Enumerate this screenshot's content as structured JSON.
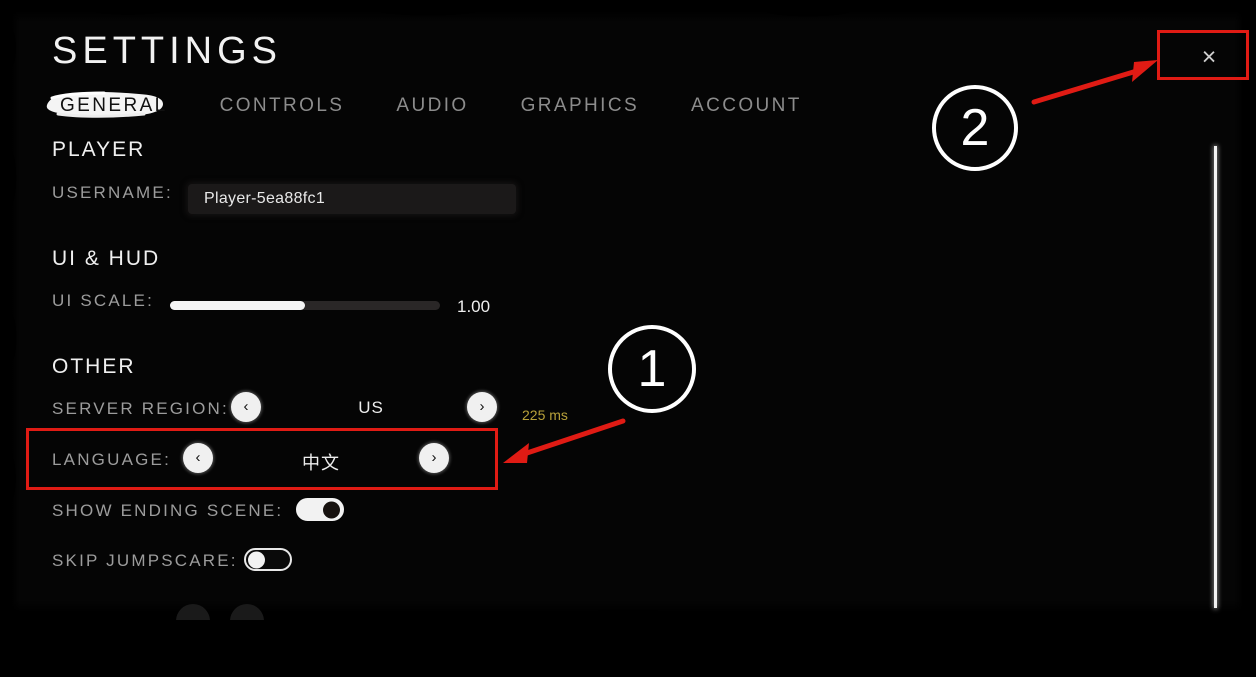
{
  "dialog": {
    "title": "SETTINGS",
    "close_label": "×",
    "close_icon": "close-icon"
  },
  "tabs": [
    {
      "label": "GENERAL",
      "active": true
    },
    {
      "label": "CONTROLS",
      "active": false
    },
    {
      "label": "AUDIO",
      "active": false
    },
    {
      "label": "GRAPHICS",
      "active": false
    },
    {
      "label": "ACCOUNT",
      "active": false
    }
  ],
  "sections": {
    "player": {
      "title": "PLAYER",
      "username": {
        "label": "USERNAME:",
        "value": "Player-5ea88fc1",
        "placeholder": "Player-5ea88fc1"
      }
    },
    "ui_hud": {
      "title": "UI & HUD",
      "ui_scale": {
        "label": "UI SCALE:",
        "value": "1.00",
        "fill_percent": 50
      }
    },
    "other": {
      "title": "OTHER",
      "server_region": {
        "label": "SERVER REGION:",
        "value": "US",
        "prev_label": "‹",
        "next_label": "›",
        "ping": "225 ms",
        "ping_color": "#b8a13a"
      },
      "language": {
        "label": "LANGUAGE:",
        "value": "中文",
        "prev_label": "‹",
        "next_label": "›"
      },
      "show_ending_scene": {
        "label": "SHOW ENDING SCENE:",
        "state": "on"
      },
      "skip_jumpscare": {
        "label": "SKIP JUMPSCARE:",
        "state": "off"
      }
    }
  },
  "annotations": {
    "marker_one": "1",
    "marker_two": "2",
    "highlight_color": "#e01b14"
  }
}
